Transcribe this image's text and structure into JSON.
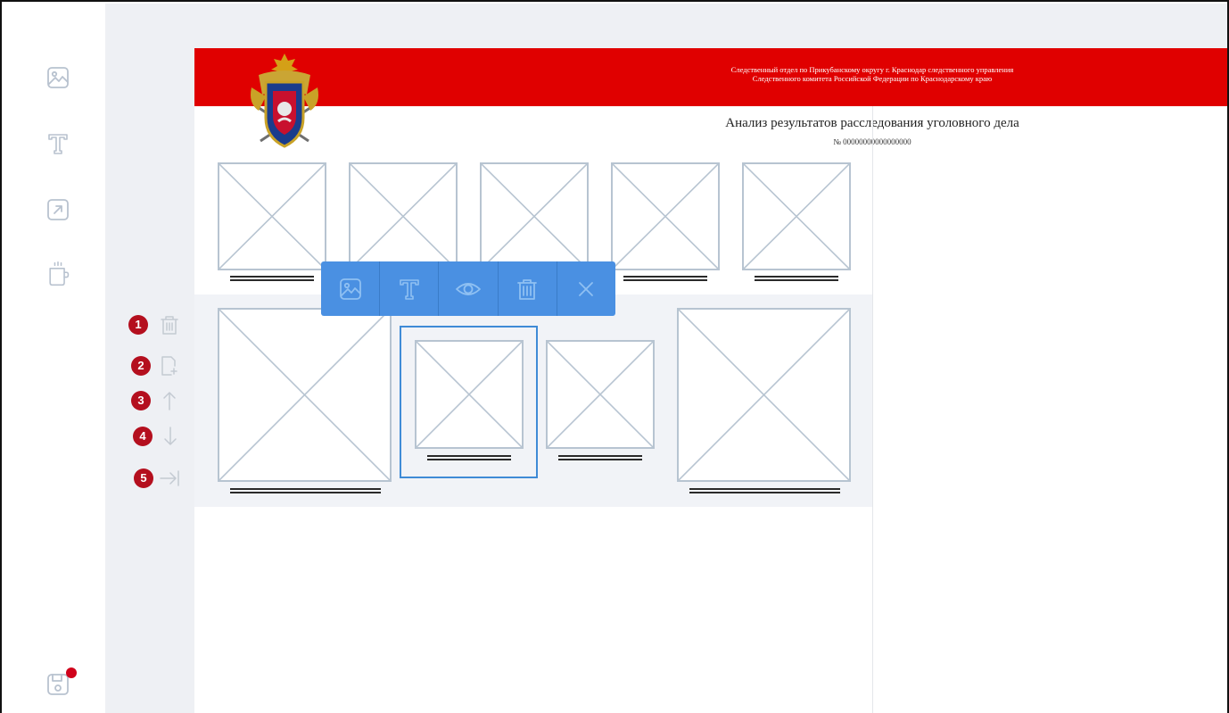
{
  "sidebar": {
    "items": [
      {
        "icon": "image-icon",
        "label": "Изображение"
      },
      {
        "icon": "text-icon",
        "label": "Текст"
      },
      {
        "icon": "export-icon",
        "label": "Экспорт"
      },
      {
        "icon": "cup-icon",
        "label": "Перерыв"
      }
    ],
    "save": {
      "icon": "save-icon",
      "has_notification": true
    }
  },
  "document": {
    "header_color": "#e00000",
    "org_line1": "Следственный отдел по Прикубанскому округу г. Краснодар следственного управления",
    "org_line2": "Следственного комитета Российской Федерации по Краснодарскому краю",
    "title": "Анализ результатов расследования уголовного дела",
    "number": "№ 00000000000000000"
  },
  "toolbar": {
    "color": "#4a90e2",
    "buttons": [
      "image-icon",
      "text-icon",
      "eye-icon",
      "trash-icon",
      "close-icon"
    ]
  },
  "actions": [
    {
      "num": "1",
      "icon": "trash-icon"
    },
    {
      "num": "2",
      "icon": "add-page-icon"
    },
    {
      "num": "3",
      "icon": "arrow-up-icon"
    },
    {
      "num": "4",
      "icon": "arrow-down-icon"
    },
    {
      "num": "5",
      "icon": "move-end-icon"
    }
  ]
}
